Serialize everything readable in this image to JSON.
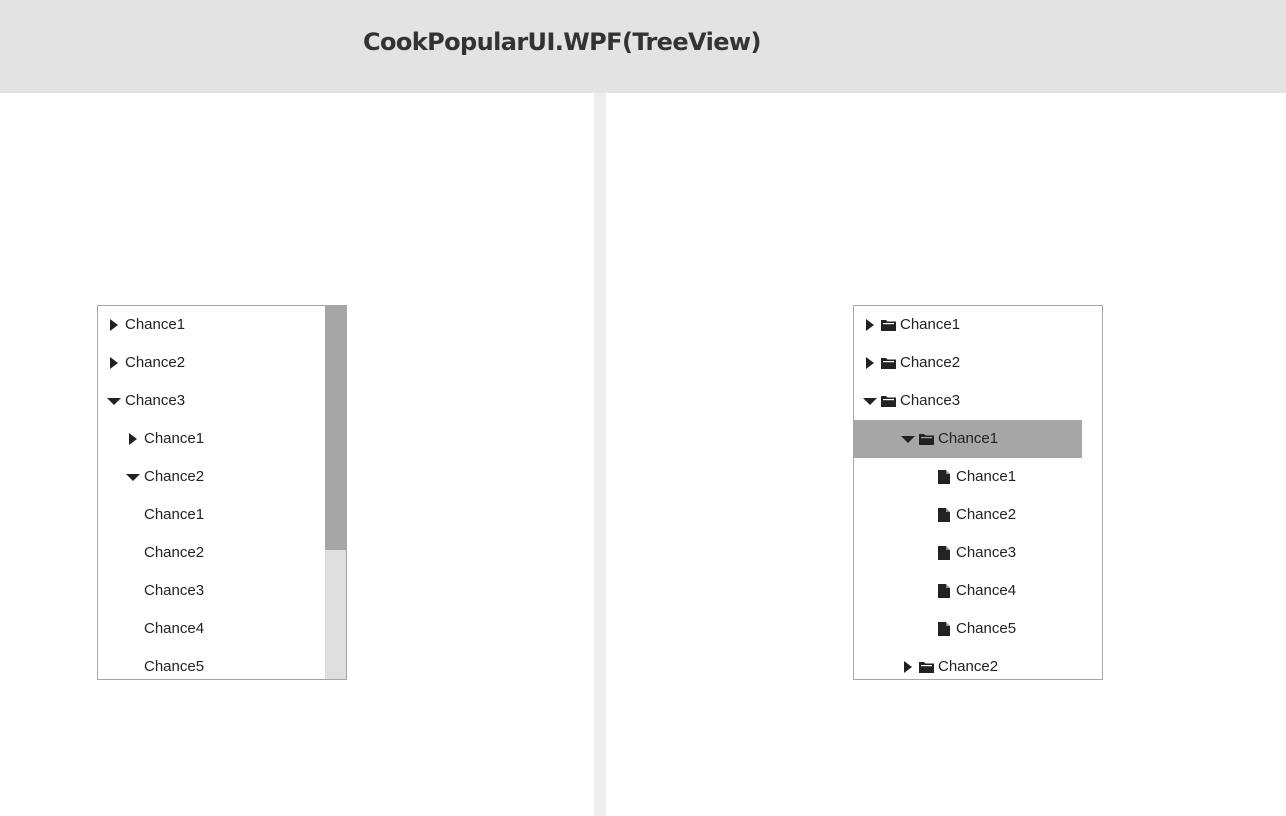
{
  "header": {
    "title": "CookPopularUI.WPF(TreeView)"
  },
  "left_tree": {
    "rows": [
      {
        "label": "Chance1",
        "expander": "collapsed"
      },
      {
        "label": "Chance2",
        "expander": "collapsed"
      },
      {
        "label": "Chance3",
        "expander": "expanded"
      },
      {
        "label": "Chance1",
        "expander": "collapsed"
      },
      {
        "label": "Chance2",
        "expander": "expanded"
      },
      {
        "label": "Chance1",
        "expander": "none"
      },
      {
        "label": "Chance2",
        "expander": "none"
      },
      {
        "label": "Chance3",
        "expander": "none"
      },
      {
        "label": "Chance4",
        "expander": "none"
      },
      {
        "label": "Chance5",
        "expander": "none"
      }
    ]
  },
  "right_tree": {
    "rows": [
      {
        "label": "Chance1",
        "expander": "collapsed",
        "icon": "folder-icon"
      },
      {
        "label": "Chance2",
        "expander": "collapsed",
        "icon": "folder-icon"
      },
      {
        "label": "Chance3",
        "expander": "expanded",
        "icon": "folder-icon"
      },
      {
        "label": "Chance1",
        "expander": "expanded",
        "icon": "folder-icon",
        "selected": true
      },
      {
        "label": "Chance1",
        "expander": "none",
        "icon": "file-icon"
      },
      {
        "label": "Chance2",
        "expander": "none",
        "icon": "file-icon"
      },
      {
        "label": "Chance3",
        "expander": "none",
        "icon": "file-icon"
      },
      {
        "label": "Chance4",
        "expander": "none",
        "icon": "file-icon"
      },
      {
        "label": "Chance5",
        "expander": "none",
        "icon": "file-icon"
      },
      {
        "label": "Chance2",
        "expander": "collapsed",
        "icon": "folder-icon"
      }
    ]
  },
  "colors": {
    "header_bg": "#e3e3e3",
    "divider": "#eeeeee",
    "selection": "#a6a6a6",
    "scroll_thumb": "#a6a6a6",
    "scroll_track": "#dedede",
    "text": "#222222"
  }
}
